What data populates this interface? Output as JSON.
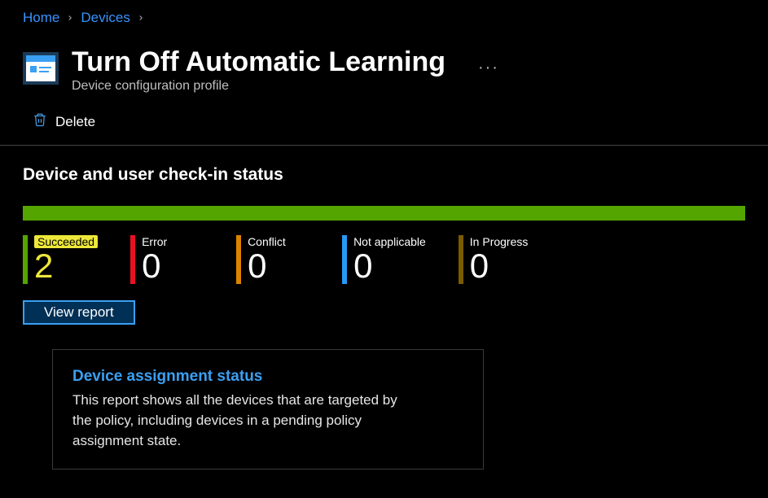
{
  "breadcrumb": {
    "home": "Home",
    "devices": "Devices"
  },
  "header": {
    "title": "Turn Off Automatic Learning",
    "subtitle": "Device configuration profile"
  },
  "toolbar": {
    "delete_label": "Delete"
  },
  "status": {
    "heading": "Device and user check-in status",
    "tiles": {
      "succeeded": {
        "label": "Succeeded",
        "value": "2",
        "color": "#55a500"
      },
      "error": {
        "label": "Error",
        "value": "0",
        "color": "#e81123"
      },
      "conflict": {
        "label": "Conflict",
        "value": "0",
        "color": "#d98300"
      },
      "na": {
        "label": "Not applicable",
        "value": "0",
        "color": "#2899f5"
      },
      "inprogress": {
        "label": "In Progress",
        "value": "0",
        "color": "#7a5c00"
      }
    },
    "view_report_label": "View report"
  },
  "card": {
    "title": "Device assignment status",
    "desc": "This report shows all the devices that are targeted by the policy, including devices in a pending policy assignment state."
  }
}
